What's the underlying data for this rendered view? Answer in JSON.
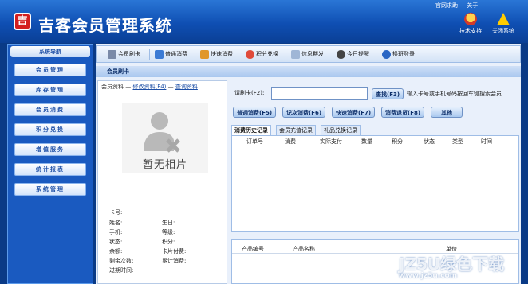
{
  "app": {
    "title": "吉客会员管理系统",
    "logo_char": "吉"
  },
  "toplinks": {
    "help": "官网求助",
    "about": "关于"
  },
  "topbuttons": [
    {
      "label": "技术支持",
      "icon": "support-icon"
    },
    {
      "label": "关闭系统",
      "icon": "warning-icon"
    }
  ],
  "sidebar": {
    "title": "系统导航",
    "items": [
      "会员管理",
      "库存管理",
      "会员消费",
      "积分兑换",
      "增值服务",
      "统计报表",
      "系统管理"
    ]
  },
  "toolbar": {
    "items": [
      "会员刷卡",
      "普通消费",
      "快速消费",
      "积分兑换",
      "信息群发",
      "今日提醒",
      "换班登录"
    ]
  },
  "section_title": "会员刷卡",
  "member": {
    "head_label": "会员资料",
    "head_sep": "—",
    "edit_link": "修改资料(F4)",
    "view_link": "查询资料",
    "photo_text": "暂无相片",
    "fields": {
      "card": "卡号:",
      "name": "姓名:",
      "birthday": "生日:",
      "phone": "手机:",
      "level": "等级:",
      "status": "状态:",
      "points": "积分:",
      "balance": "余额:",
      "card_fee": "卡片付费:",
      "remaining": "剩余次数:",
      "total_spend": "累计消费:",
      "expiry": "过期时间:"
    }
  },
  "search": {
    "label": "请刷卡(F2):",
    "value": "",
    "button": "查找(F3)",
    "hint": "输入卡号或手机号码按回车键搜索会员"
  },
  "actions": [
    "普通消费(F5)",
    "记次消费(F6)",
    "快速消费(F7)",
    "消费退货(F8)",
    "其他"
  ],
  "tabs": [
    "消费历史记录",
    "会员充值记录",
    "礼品兑换记录"
  ],
  "history_columns": [
    "订单号",
    "消费",
    "实际支付",
    "数量",
    "积分",
    "状态",
    "类型",
    "时间"
  ],
  "product_columns": [
    "产品编号",
    "产品名称",
    "单价"
  ],
  "watermark": {
    "text": "JZ5U绿色下载",
    "url": "www.jz5u.com"
  }
}
